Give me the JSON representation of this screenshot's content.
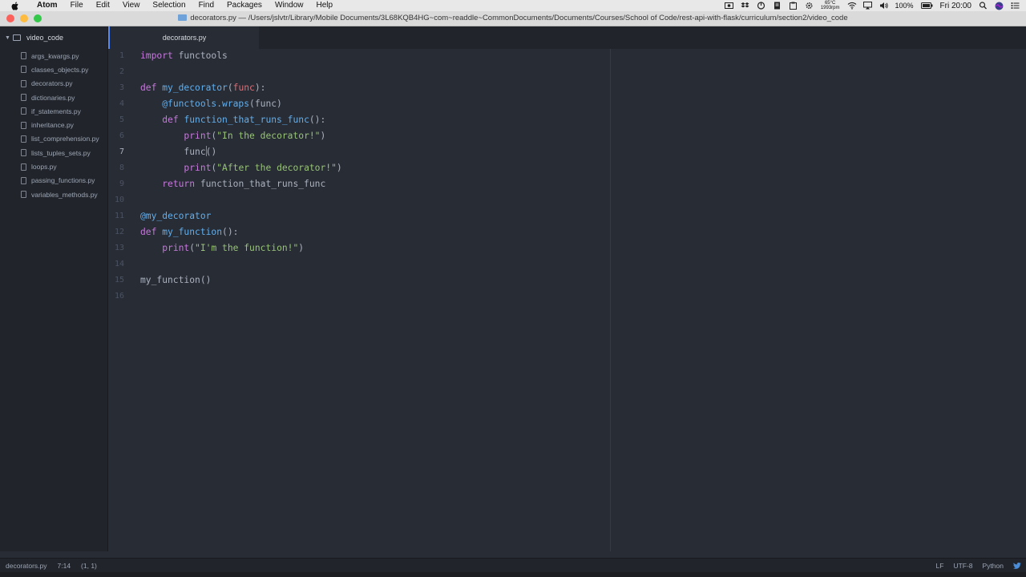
{
  "menubar": {
    "app": "Atom",
    "items": [
      "File",
      "Edit",
      "View",
      "Selection",
      "Find",
      "Packages",
      "Window",
      "Help"
    ],
    "temperature": "65°C",
    "fan": "1993rpm",
    "battery": "100%",
    "clock": "Fri 20:00"
  },
  "window": {
    "title": "decorators.py — /Users/jslvtr/Library/Mobile Documents/3L68KQB4HG~com~readdle~CommonDocuments/Documents/Courses/School of Code/rest-api-with-flask/curriculum/section2/video_code"
  },
  "tree": {
    "root": "video_code",
    "files": [
      "args_kwargs.py",
      "classes_objects.py",
      "decorators.py",
      "dictionaries.py",
      "if_statements.py",
      "inheritance.py",
      "list_comprehension.py",
      "lists_tuples_sets.py",
      "loops.py",
      "passing_functions.py",
      "variables_methods.py"
    ]
  },
  "tab": {
    "label": "decorators.py"
  },
  "editor": {
    "active_line": 7,
    "line_numbers": [
      "1",
      "2",
      "3",
      "4",
      "5",
      "6",
      "7",
      "8",
      "9",
      "10",
      "11",
      "12",
      "13",
      "14",
      "15",
      "16"
    ],
    "code": {
      "l1_kw": "import",
      "l1_rest": " functools",
      "l3_kw": "def",
      "l3_fn": "my_decorator",
      "l3_open": "(",
      "l3_param": "func",
      "l3_close": "):",
      "l4_deco": "@functools.wraps",
      "l4_rest": "(func)",
      "l6_kw": "def",
      "l6_fn": "function_that_runs_func",
      "l6_rest": "():",
      "l7_fn": "print",
      "l7_open": "(",
      "l7_str": "\"In the decorator!\"",
      "l7_close": ")",
      "l8_a": "func",
      "l8_b": "()",
      "l9_fn": "print",
      "l9_open": "(",
      "l9_str": "\"After the decorator!\"",
      "l9_close": ")",
      "l10_kw": "return",
      "l10_rest": " function_that_runs_func",
      "l12_deco": "@my_decorator",
      "l13_kw": "def",
      "l13_fn": "my_function",
      "l13_rest": "():",
      "l14_fn": "print",
      "l14_open": "(",
      "l14_str": "\"I'm the function!\"",
      "l14_close": ")",
      "l16_call": "my_function()"
    }
  },
  "statusbar": {
    "file": "decorators.py",
    "position": "7:14",
    "selection": "(1, 1)",
    "line_ending": "LF",
    "encoding": "UTF-8",
    "grammar": "Python"
  },
  "colors": {
    "accent": "#568af2",
    "editor_bg": "#282c34",
    "panel_bg": "#21252b"
  }
}
